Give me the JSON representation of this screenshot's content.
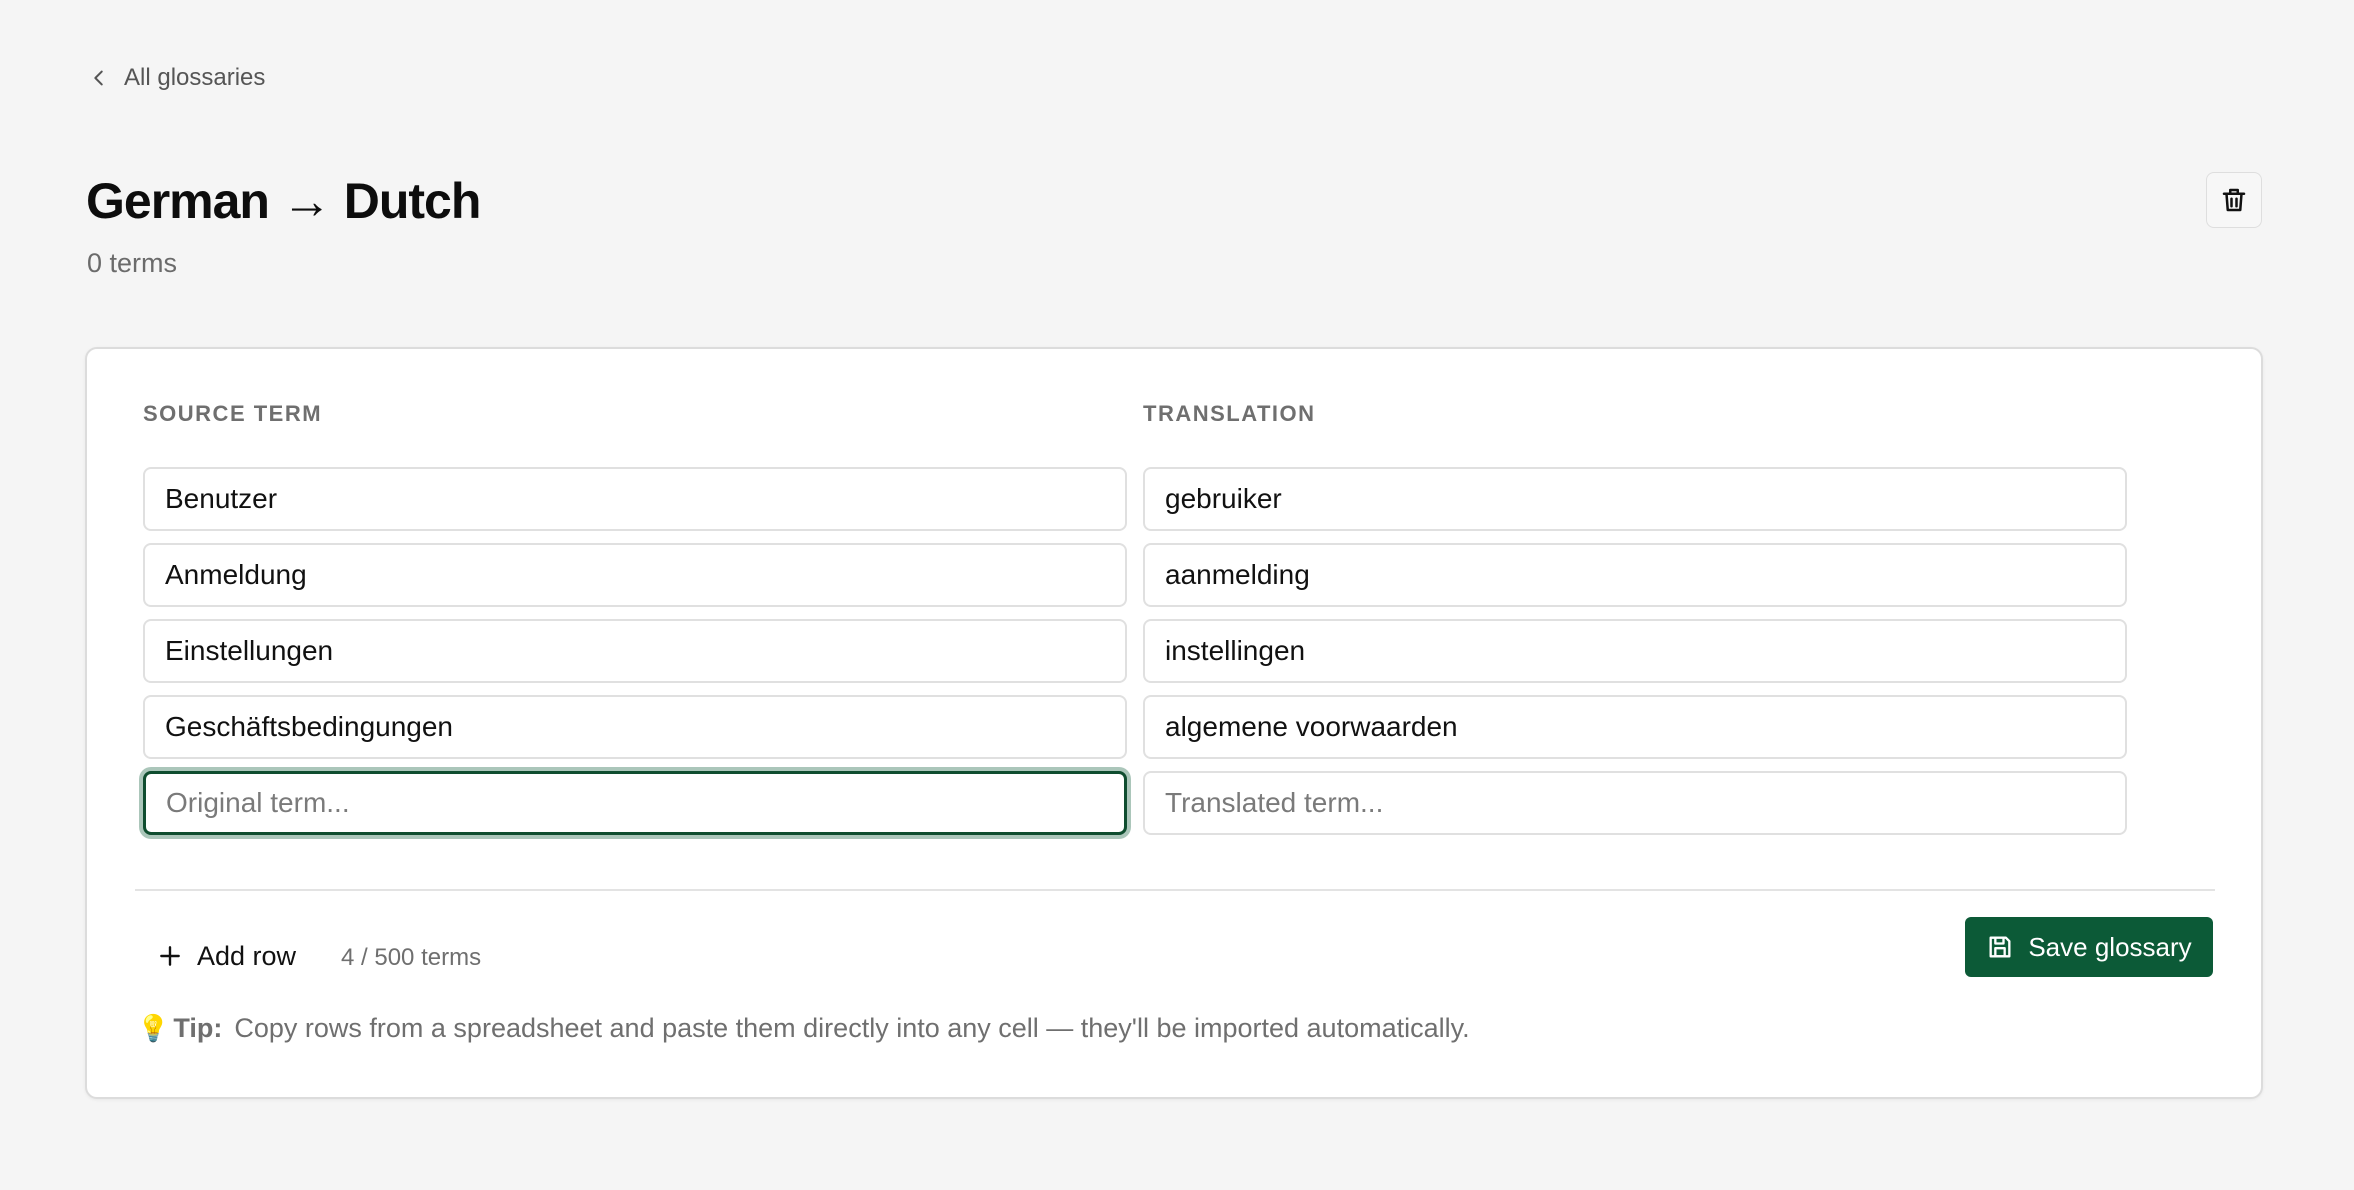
{
  "nav": {
    "back_label": "All glossaries"
  },
  "header": {
    "title": "German → Dutch",
    "term_count": "0 terms"
  },
  "table": {
    "source_header": "SOURCE TERM",
    "translation_header": "TRANSLATION",
    "rows": [
      {
        "source": "Benutzer",
        "translation": "gebruiker"
      },
      {
        "source": "Anmeldung",
        "translation": "aanmelding"
      },
      {
        "source": "Einstellungen",
        "translation": "instellingen"
      },
      {
        "source": "Geschäftsbedingungen",
        "translation": "algemene voorwaarden"
      }
    ],
    "new_row": {
      "source_value": "",
      "source_placeholder": "Original term...",
      "translation_value": "",
      "translation_placeholder": "Translated term..."
    }
  },
  "footer": {
    "add_row_label": "Add row",
    "terms_limit": "4 / 500 terms",
    "save_label": "Save glossary"
  },
  "tip": {
    "label": "Tip:",
    "text": "Copy rows from a spreadsheet and paste them directly into any cell — they'll be imported automatically."
  },
  "colors": {
    "primary": "#0c5a37",
    "focus_ring": "#0f4d2f",
    "background": "#f5f5f5"
  },
  "icons": {
    "back": "chevron-left-icon",
    "delete": "trash-icon",
    "add": "plus-icon",
    "save": "floppy-disk-icon",
    "tip": "lightbulb-icon"
  }
}
